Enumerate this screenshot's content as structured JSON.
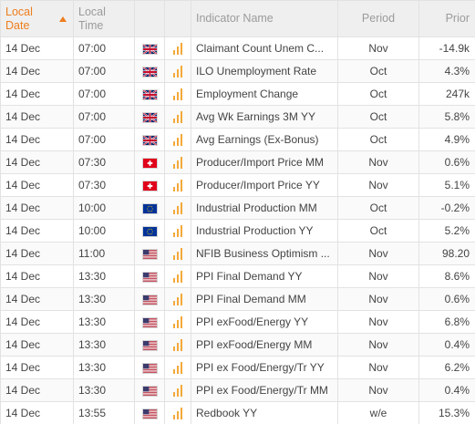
{
  "columns": {
    "local_date": "Local Date",
    "local_time": "Local Time",
    "indicator_name": "Indicator Name",
    "period": "Period",
    "prior": "Prior"
  },
  "sort": {
    "column": "local_date",
    "direction": "ascending"
  },
  "colors": {
    "accent": "#ee7d1d",
    "importance": "#f4a93a"
  },
  "rows": [
    {
      "date": "14 Dec",
      "time": "07:00",
      "country": "gb",
      "flag_icon": "uk-flag-icon",
      "importance": 3,
      "name": "Claimant Count Unem C...",
      "period": "Nov",
      "prior": "-14.9k"
    },
    {
      "date": "14 Dec",
      "time": "07:00",
      "country": "gb",
      "flag_icon": "uk-flag-icon",
      "importance": 3,
      "name": "ILO Unemployment Rate",
      "period": "Oct",
      "prior": "4.3%"
    },
    {
      "date": "14 Dec",
      "time": "07:00",
      "country": "gb",
      "flag_icon": "uk-flag-icon",
      "importance": 3,
      "name": "Employment Change",
      "period": "Oct",
      "prior": "247k"
    },
    {
      "date": "14 Dec",
      "time": "07:00",
      "country": "gb",
      "flag_icon": "uk-flag-icon",
      "importance": 3,
      "name": "Avg Wk Earnings 3M YY",
      "period": "Oct",
      "prior": "5.8%"
    },
    {
      "date": "14 Dec",
      "time": "07:00",
      "country": "gb",
      "flag_icon": "uk-flag-icon",
      "importance": 3,
      "name": "Avg Earnings (Ex-Bonus)",
      "period": "Oct",
      "prior": "4.9%"
    },
    {
      "date": "14 Dec",
      "time": "07:30",
      "country": "ch",
      "flag_icon": "swiss-flag-icon",
      "importance": 3,
      "name": "Producer/Import Price MM",
      "period": "Nov",
      "prior": "0.6%"
    },
    {
      "date": "14 Dec",
      "time": "07:30",
      "country": "ch",
      "flag_icon": "swiss-flag-icon",
      "importance": 3,
      "name": "Producer/Import Price YY",
      "period": "Nov",
      "prior": "5.1%"
    },
    {
      "date": "14 Dec",
      "time": "10:00",
      "country": "eu",
      "flag_icon": "eu-flag-icon",
      "importance": 3,
      "name": "Industrial Production MM",
      "period": "Oct",
      "prior": "-0.2%"
    },
    {
      "date": "14 Dec",
      "time": "10:00",
      "country": "eu",
      "flag_icon": "eu-flag-icon",
      "importance": 3,
      "name": "Industrial Production YY",
      "period": "Oct",
      "prior": "5.2%"
    },
    {
      "date": "14 Dec",
      "time": "11:00",
      "country": "us",
      "flag_icon": "us-flag-icon",
      "importance": 3,
      "name": "NFIB Business Optimism ...",
      "period": "Nov",
      "prior": "98.20"
    },
    {
      "date": "14 Dec",
      "time": "13:30",
      "country": "us",
      "flag_icon": "us-flag-icon",
      "importance": 3,
      "name": "PPI Final Demand YY",
      "period": "Nov",
      "prior": "8.6%"
    },
    {
      "date": "14 Dec",
      "time": "13:30",
      "country": "us",
      "flag_icon": "us-flag-icon",
      "importance": 3,
      "name": "PPI Final Demand MM",
      "period": "Nov",
      "prior": "0.6%"
    },
    {
      "date": "14 Dec",
      "time": "13:30",
      "country": "us",
      "flag_icon": "us-flag-icon",
      "importance": 3,
      "name": "PPI exFood/Energy YY",
      "period": "Nov",
      "prior": "6.8%"
    },
    {
      "date": "14 Dec",
      "time": "13:30",
      "country": "us",
      "flag_icon": "us-flag-icon",
      "importance": 3,
      "name": "PPI exFood/Energy MM",
      "period": "Nov",
      "prior": "0.4%"
    },
    {
      "date": "14 Dec",
      "time": "13:30",
      "country": "us",
      "flag_icon": "us-flag-icon",
      "importance": 3,
      "name": "PPI ex Food/Energy/Tr YY",
      "period": "Nov",
      "prior": "6.2%"
    },
    {
      "date": "14 Dec",
      "time": "13:30",
      "country": "us",
      "flag_icon": "us-flag-icon",
      "importance": 3,
      "name": "PPI ex Food/Energy/Tr MM",
      "period": "Nov",
      "prior": "0.4%"
    },
    {
      "date": "14 Dec",
      "time": "13:55",
      "country": "us",
      "flag_icon": "us-flag-icon",
      "importance": 3,
      "name": "Redbook YY",
      "period": "w/e",
      "prior": "15.3%"
    }
  ]
}
